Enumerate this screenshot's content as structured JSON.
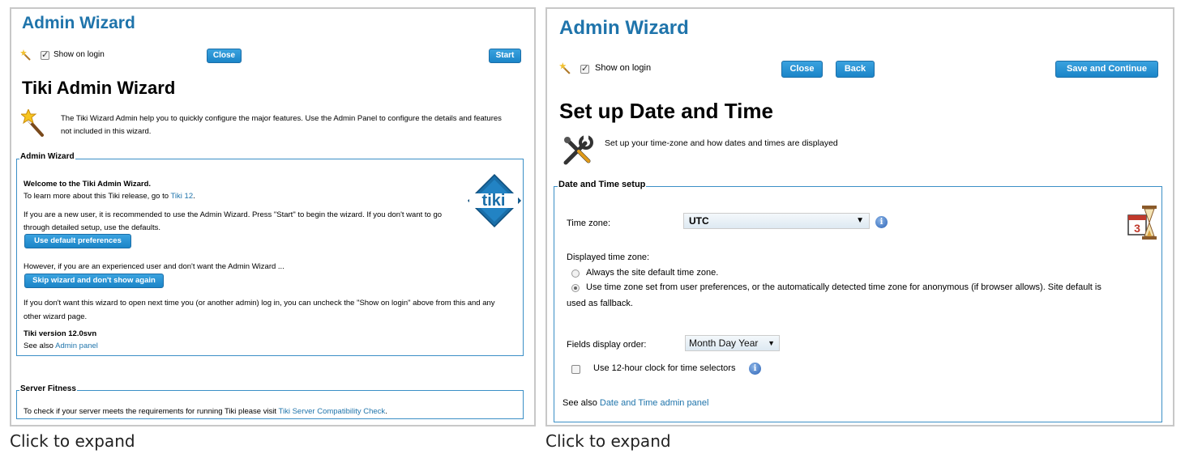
{
  "captions": [
    "Click to expand",
    "Click to expand"
  ],
  "left": {
    "header_title": "Admin Wizard",
    "show_on_login": "Show on login",
    "show_on_login_checked": true,
    "close_label": "Close",
    "start_label": "Start",
    "page_title": "Tiki Admin Wizard",
    "intro_line1": "The Tiki Wizard Admin help you to quickly configure the major features. Use the Admin Panel to configure the details and features",
    "intro_line2": "not included in this wizard.",
    "fieldset_legend": "Admin Wizard",
    "welcome": "Welcome to the Tiki Admin Wizard.",
    "learn_more": "To learn more about this Tiki release, go to",
    "learn_more_link": "Tiki 12",
    "learn_more_end": ".",
    "new_user_line1": "If you are a new user, it is recommended to use the Admin Wizard. Press \"Start\" to begin the wizard. If you don't want to go",
    "new_user_line2": "through detailed setup, use the defaults.",
    "use_defaults_label": "Use default preferences",
    "experienced": "However, if you are an experienced user and don't want the Admin Wizard ...",
    "skip_label": "Skip wizard and don't show again",
    "uncheck_line1": "If you don't want this wizard to open next time you (or another admin) log in, you can uncheck the \"Show on login\" above from this and any",
    "uncheck_line2": "other wizard page.",
    "version": "Tiki version 12.0svn",
    "see_also": "See also",
    "admin_panel_link": "Admin panel",
    "logo_text": "tiki",
    "server_legend": "Server Fitness",
    "server_text": "To check if your server meets the requirements for running Tiki please visit",
    "server_link": "Tiki Server Compatibility Check",
    "server_end": "."
  },
  "right": {
    "header_title": "Admin Wizard",
    "show_on_login": "Show on login",
    "show_on_login_checked": true,
    "close_label": "Close",
    "back_label": "Back",
    "save_label": "Save and Continue",
    "page_title": "Set up Date and Time",
    "intro": "Set up your time-zone and how dates and times are displayed",
    "fieldset_legend": "Date and Time setup",
    "tz_label": "Time zone:",
    "tz_value": "UTC",
    "displayed_tz_label": "Displayed time zone:",
    "radio1_label": "Always the site default time zone.",
    "radio1_selected": false,
    "radio2_line1": "Use time zone set from user preferences, or the automatically detected time zone for anonymous (if browser allows). Site default is",
    "radio2_line2": "used as fallback.",
    "radio2_selected": true,
    "order_label": "Fields display order:",
    "order_value": "Month Day Year",
    "clock_label": "Use 12-hour clock for time selectors",
    "clock_checked": false,
    "see_also": "See also",
    "see_also_link": "Date and Time admin panel",
    "calendar_day": "3"
  }
}
